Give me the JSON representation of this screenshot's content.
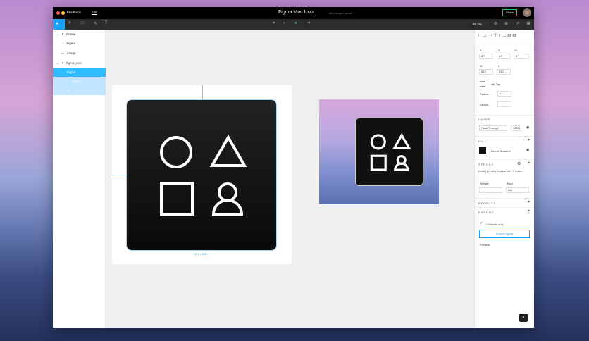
{
  "titlebar": {
    "feedback": "Feedback",
    "tab": "Edit",
    "file_title": "Figma Mac Icon",
    "status": "All changes saved",
    "share": "Share"
  },
  "toolbar": {
    "zoom": "66.2%"
  },
  "layers": [
    {
      "label": "Frame",
      "icon": "frame-icon",
      "state": "normal"
    },
    {
      "label": "Figma",
      "icon": "component-icon",
      "state": "normal"
    },
    {
      "label": "image",
      "icon": "image-icon",
      "state": "normal"
    },
    {
      "label": "figma_icon",
      "icon": "frame-icon",
      "state": "normal"
    },
    {
      "label": "Figma",
      "icon": "group-icon",
      "state": "selected"
    },
    {
      "label": "Figma",
      "icon": "vector-icon",
      "state": "child"
    },
    {
      "label": "",
      "icon": "rectangle-icon",
      "state": "child"
    }
  ],
  "canvas": {
    "size_label": "512 x 512"
  },
  "props": {
    "x_label": "X",
    "x": "87",
    "y_label": "Y",
    "y": "87",
    "r_label": "SL",
    "r": "0°",
    "w_label": "W",
    "w": "512",
    "h_label": "H",
    "h": "512",
    "constraint": "Left, Top",
    "radius_label": "Radius",
    "radius": "0",
    "device_label": "Device",
    "device": ""
  },
  "layer": {
    "title": "LAYER",
    "blend": "Pass Through",
    "opacity": "100%"
  },
  "fill": {
    "title": "FILL",
    "type": "Linear Gradient",
    "color": "#111111"
  },
  "stroke": {
    "title": "STROKE",
    "note": "(Inside) (Center), replace with 'Y' button.)",
    "weight_label": "Weight",
    "align_label": "Align",
    "align": "Idle"
  },
  "effects": {
    "title": "EFFECTS"
  },
  "export": {
    "title": "EXPORT",
    "checkbox": "Contents only",
    "button": "Export Figma",
    "preview": "Preview"
  },
  "colors": {
    "accent": "#18a0fb",
    "selected": "#2cbcff",
    "child": "#bfe4ff"
  }
}
